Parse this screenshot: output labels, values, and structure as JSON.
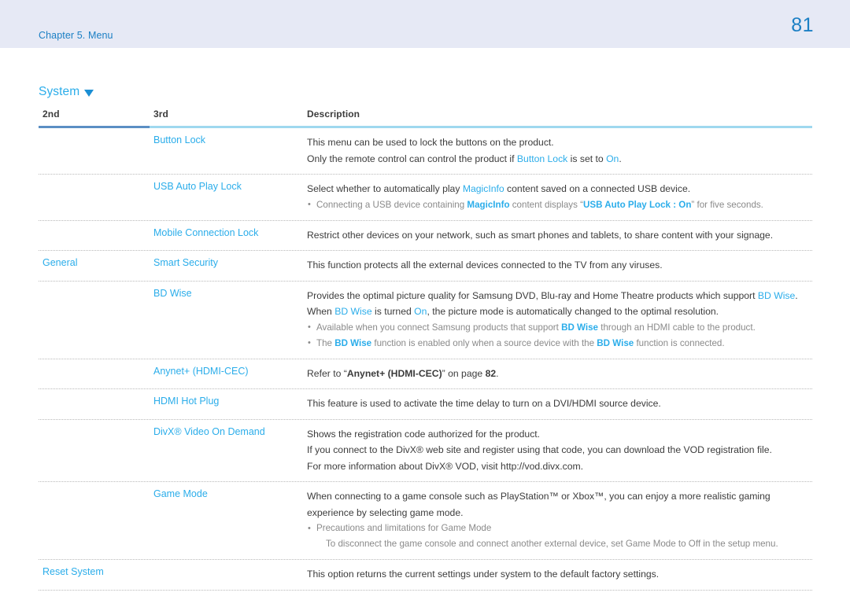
{
  "header": {
    "chapter": "Chapter 5. Menu",
    "page_number": "81",
    "band_color": "#e6e9f5",
    "text_color": "#1b7fc4"
  },
  "section": {
    "title": "System",
    "caret_icon": "caret-down-icon"
  },
  "colors": {
    "link_blue": "#2badea",
    "body_text": "#3c3c3c",
    "muted_text": "#8a8a8a",
    "rule_dark": "#5b8fc4",
    "rule_light": "#9fd8ef"
  },
  "table": {
    "columns": [
      "2nd",
      "3rd",
      "Description"
    ],
    "rows": [
      {
        "second": "",
        "third": "Button Lock",
        "lines": [
          {
            "type": "text",
            "parts": [
              {
                "t": "This menu can be used to lock the buttons on the product.",
                "s": "n"
              }
            ]
          },
          {
            "type": "text",
            "parts": [
              {
                "t": "Only the remote control can control the product if ",
                "s": "n"
              },
              {
                "t": "Button Lock",
                "s": "hl"
              },
              {
                "t": " is set to ",
                "s": "n"
              },
              {
                "t": "On",
                "s": "hl"
              },
              {
                "t": ".",
                "s": "n"
              }
            ]
          }
        ]
      },
      {
        "second": "",
        "third": "USB Auto Play Lock",
        "lines": [
          {
            "type": "text",
            "parts": [
              {
                "t": "Select whether to automatically play ",
                "s": "n"
              },
              {
                "t": "MagicInfo",
                "s": "hl"
              },
              {
                "t": " content saved on a connected USB device.",
                "s": "n"
              }
            ]
          },
          {
            "type": "bullet",
            "parts": [
              {
                "t": "Connecting a USB device containing ",
                "s": "n"
              },
              {
                "t": "MagicInfo",
                "s": "hlb"
              },
              {
                "t": " content displays “",
                "s": "n"
              },
              {
                "t": "USB Auto Play Lock : On",
                "s": "hlb"
              },
              {
                "t": "” for five seconds.",
                "s": "n"
              }
            ]
          }
        ]
      },
      {
        "second": "",
        "third": "Mobile Connection Lock",
        "lines": [
          {
            "type": "text",
            "parts": [
              {
                "t": "Restrict other devices on your network, such as smart phones and tablets, to share content with your signage.",
                "s": "n"
              }
            ]
          }
        ]
      },
      {
        "second": "General",
        "third": "Smart Security",
        "lines": [
          {
            "type": "text",
            "parts": [
              {
                "t": "This function protects all the external devices connected to the TV from any viruses.",
                "s": "n"
              }
            ]
          }
        ]
      },
      {
        "second": "",
        "third": "BD Wise",
        "lines": [
          {
            "type": "text",
            "parts": [
              {
                "t": "Provides the optimal picture quality for Samsung DVD, Blu-ray and Home Theatre products which support ",
                "s": "n"
              },
              {
                "t": "BD Wise",
                "s": "hl"
              },
              {
                "t": ".",
                "s": "n"
              }
            ]
          },
          {
            "type": "text",
            "parts": [
              {
                "t": "When ",
                "s": "n"
              },
              {
                "t": "BD Wise",
                "s": "hl"
              },
              {
                "t": " is turned ",
                "s": "n"
              },
              {
                "t": "On",
                "s": "hl"
              },
              {
                "t": ", the picture mode is automatically changed to the optimal resolution.",
                "s": "n"
              }
            ]
          },
          {
            "type": "bullet",
            "parts": [
              {
                "t": "Available when you connect Samsung products that support ",
                "s": "n"
              },
              {
                "t": "BD Wise",
                "s": "hlb"
              },
              {
                "t": " through an HDMI cable to the product.",
                "s": "n"
              }
            ]
          },
          {
            "type": "bullet",
            "parts": [
              {
                "t": "The ",
                "s": "n"
              },
              {
                "t": "BD Wise",
                "s": "hlb"
              },
              {
                "t": " function is enabled only when a source device with the ",
                "s": "n"
              },
              {
                "t": "BD Wise",
                "s": "hlb"
              },
              {
                "t": " function is connected.",
                "s": "n"
              }
            ]
          }
        ]
      },
      {
        "second": "",
        "third": "Anynet+ (HDMI-CEC)",
        "lines": [
          {
            "type": "text",
            "parts": [
              {
                "t": "Refer to “",
                "s": "n"
              },
              {
                "t": "Anynet+ (HDMI-CEC)",
                "s": "b"
              },
              {
                "t": "” on page ",
                "s": "n"
              },
              {
                "t": "82",
                "s": "b"
              },
              {
                "t": ".",
                "s": "n"
              }
            ]
          }
        ]
      },
      {
        "second": "",
        "third": "HDMI Hot Plug",
        "lines": [
          {
            "type": "text",
            "parts": [
              {
                "t": "This feature is used to activate the time delay to turn on a DVI/HDMI source device.",
                "s": "n"
              }
            ]
          }
        ]
      },
      {
        "second": "",
        "third": "DivX® Video On Demand",
        "lines": [
          {
            "type": "text",
            "parts": [
              {
                "t": "Shows the registration code authorized for the product.",
                "s": "n"
              }
            ]
          },
          {
            "type": "text",
            "parts": [
              {
                "t": "If you connect to the DivX® web site and register using that code, you can download the VOD registration file.",
                "s": "n"
              }
            ]
          },
          {
            "type": "text",
            "parts": [
              {
                "t": "For more information about DivX® VOD, visit http://vod.divx.com.",
                "s": "n"
              }
            ]
          }
        ]
      },
      {
        "second": "",
        "third": "Game Mode",
        "lines": [
          {
            "type": "text",
            "parts": [
              {
                "t": "When connecting to a game console such as PlayStation™ or Xbox™, you can enjoy a more realistic gaming",
                "s": "n"
              }
            ]
          },
          {
            "type": "text",
            "parts": [
              {
                "t": "experience by selecting game mode.",
                "s": "n"
              }
            ]
          },
          {
            "type": "bullet",
            "parts": [
              {
                "t": "Precautions and limitations for Game Mode",
                "s": "n"
              }
            ]
          },
          {
            "type": "sub",
            "parts": [
              {
                "t": "To disconnect the game console and connect another external device, set Game Mode to Off in the setup menu.",
                "s": "n"
              }
            ]
          }
        ]
      },
      {
        "second": "Reset System",
        "third": "",
        "span": true,
        "lines": [
          {
            "type": "text",
            "parts": [
              {
                "t": "This option returns the current settings under system to the default factory settings.",
                "s": "n"
              }
            ]
          }
        ]
      }
    ]
  }
}
